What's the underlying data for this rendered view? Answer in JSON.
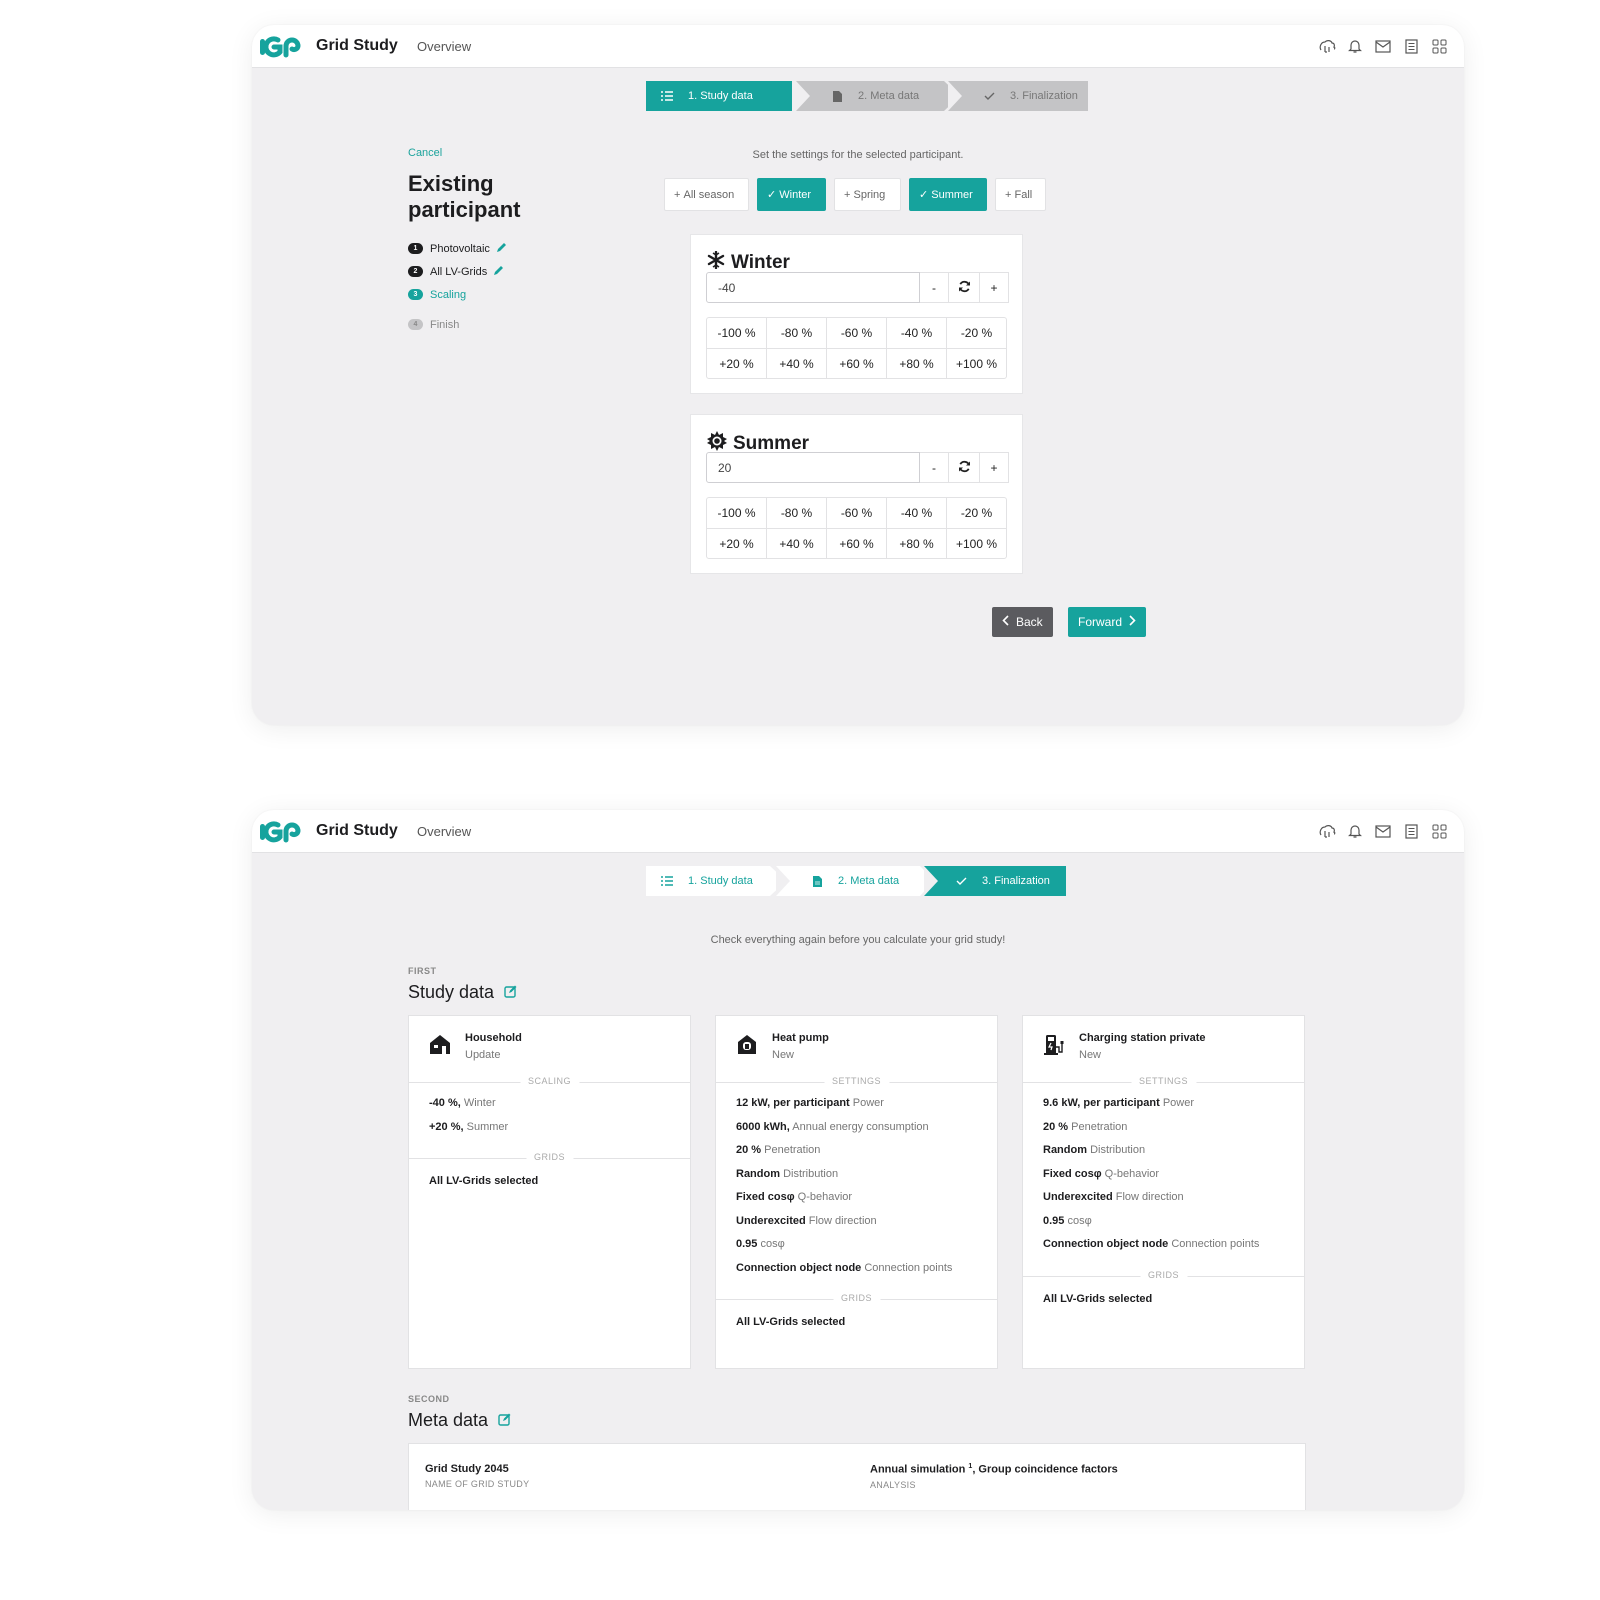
{
  "app": {
    "title": "Grid Study",
    "nav_overview": "Overview",
    "toolbar_icons": [
      "elephant-icon",
      "bell-icon",
      "mail-icon",
      "book-icon",
      "apps-grid-icon"
    ]
  },
  "steps": [
    {
      "label": "1. Study data",
      "icon": "list-icon"
    },
    {
      "label": "2. Meta data",
      "icon": "file-icon"
    },
    {
      "label": "3. Finalization",
      "icon": "check-icon"
    }
  ],
  "screen1": {
    "active_step": 0,
    "cancel": "Cancel",
    "title": "Existing participant",
    "wizard": [
      {
        "num": "1",
        "label": "Photovoltaic",
        "state": "done",
        "editable": true
      },
      {
        "num": "2",
        "label": "All LV-Grids",
        "state": "done",
        "editable": true
      },
      {
        "num": "3",
        "label": "Scaling",
        "state": "active",
        "editable": false
      },
      {
        "num": "4",
        "label": "Finish",
        "state": "pending",
        "editable": false
      }
    ],
    "hint": "Set the settings for the selected participant.",
    "seasons": [
      {
        "label": "All season",
        "selected": false
      },
      {
        "label": "Winter",
        "selected": true
      },
      {
        "label": "Spring",
        "selected": false
      },
      {
        "label": "Summer",
        "selected": true
      },
      {
        "label": "Fall",
        "selected": false
      }
    ],
    "season_cards": [
      {
        "title": "Winter",
        "icon": "snowflake-icon",
        "value": "-40",
        "minus": "-",
        "plus": "+",
        "presets_row1": [
          "-100 %",
          "-80 %",
          "-60 %",
          "-40 %",
          "-20 %"
        ],
        "presets_row2": [
          "+20 %",
          "+40 %",
          "+60 %",
          "+80 %",
          "+100 %"
        ]
      },
      {
        "title": "Summer",
        "icon": "sun-icon",
        "value": "20",
        "minus": "-",
        "plus": "+",
        "presets_row1": [
          "-100 %",
          "-80 %",
          "-60 %",
          "-40 %",
          "-20 %"
        ],
        "presets_row2": [
          "+20 %",
          "+40 %",
          "+60 %",
          "+80 %",
          "+100 %"
        ]
      }
    ],
    "back": "Back",
    "forward": "Forward"
  },
  "screen2": {
    "active_step": 2,
    "hint": "Check everything again before you calculate your grid study!",
    "study_section": {
      "eyebrow": "FIRST",
      "title": "Study data"
    },
    "meta_section": {
      "eyebrow": "SECOND",
      "title": "Meta data"
    },
    "cards": [
      {
        "name": "Household",
        "status": "Update",
        "icon": "house-icon",
        "section1": "SCALING",
        "lines": [
          {
            "b": "-40 %,",
            "d": "Winter"
          },
          {
            "b": "+20 %,",
            "d": "Summer"
          }
        ],
        "section2": "GRIDS",
        "grids": "All LV-Grids selected"
      },
      {
        "name": "Heat pump",
        "status": "New",
        "icon": "heat-pump-icon",
        "section1": "SETTINGS",
        "lines": [
          {
            "b": "12 kW, per participant",
            "d": "Power"
          },
          {
            "b": "6000 kWh,",
            "d": "Annual energy consumption"
          },
          {
            "b": "20 %",
            "d": "Penetration"
          },
          {
            "b": "Random",
            "d": "Distribution"
          },
          {
            "b": "Fixed cosφ",
            "d": "Q-behavior"
          },
          {
            "b": "Underexcited",
            "d": "Flow direction"
          },
          {
            "b": "0.95",
            "d": "cosφ"
          },
          {
            "b": "Connection object node",
            "d": "Connection points"
          }
        ],
        "section2": "GRIDS",
        "grids": "All LV-Grids selected"
      },
      {
        "name": "Charging station private",
        "status": "New",
        "icon": "charging-station-icon",
        "section1": "SETTINGS",
        "lines": [
          {
            "b": "9.6 kW, per participant",
            "d": "Power"
          },
          {
            "b": "20 %",
            "d": "Penetration"
          },
          {
            "b": "Random",
            "d": "Distribution"
          },
          {
            "b": "Fixed cosφ",
            "d": "Q-behavior"
          },
          {
            "b": "Underexcited",
            "d": "Flow direction"
          },
          {
            "b": "0.95",
            "d": "cosφ"
          },
          {
            "b": "Connection object node",
            "d": "Connection points"
          }
        ],
        "section2": "GRIDS",
        "grids": "All LV-Grids selected"
      }
    ],
    "meta": [
      {
        "value": "Grid Study 2045",
        "label": "NAME OF GRID STUDY"
      },
      {
        "value": "Annual simulation",
        "sup": "1",
        "value_rest": ", Group coincidence factors",
        "label": "ANALYSIS"
      }
    ]
  },
  "colors": {
    "accent": "#16a39d",
    "inactive_step": "#c4c4c6",
    "back_button": "#5b5b5f"
  }
}
